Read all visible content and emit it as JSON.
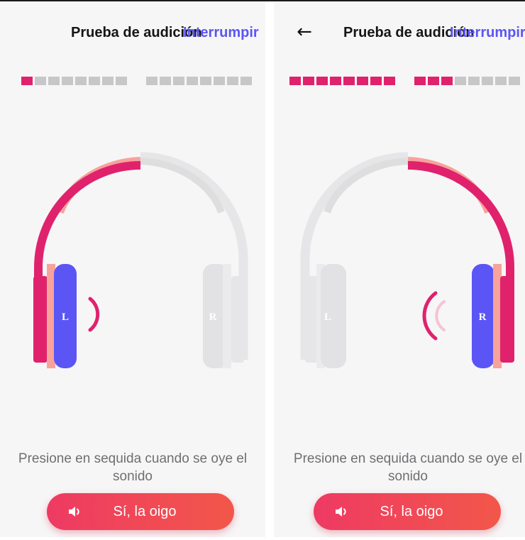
{
  "screens": [
    {
      "header": {
        "title": "Prueba de audición",
        "stop_label": "Interrumpir",
        "has_back": false
      },
      "progress": {
        "group1_filled": 1,
        "group1_total": 8,
        "group2_filled": 0,
        "group2_total": 8
      },
      "headphones": {
        "active_ear": "L",
        "left_label": "L",
        "right_label": "R"
      },
      "instruction": "Presione en sequida cuando se oye el sonido",
      "button_label": "Sí, la oigo"
    },
    {
      "header": {
        "title": "Prueba de audición",
        "stop_label": "Interrumpir",
        "has_back": true
      },
      "progress": {
        "group1_filled": 8,
        "group1_total": 8,
        "group2_filled": 3,
        "group2_total": 8
      },
      "headphones": {
        "active_ear": "R",
        "left_label": "L",
        "right_label": "R"
      },
      "instruction": "Presione en sequida cuando se oye el sonido",
      "button_label": "Sí, la oigo"
    }
  ],
  "icons": {
    "back": "arrow-left-icon",
    "speaker": "speaker-icon"
  },
  "colors": {
    "accent_pink": "#e0226d",
    "accent_salmon": "#f7a39b",
    "cup_blue": "#5b55f5",
    "stop_link": "#5b55f5",
    "inactive_gray": "#c7c7c9",
    "button_gradient_start": "#ee3a63",
    "button_gradient_end": "#f2574a"
  }
}
